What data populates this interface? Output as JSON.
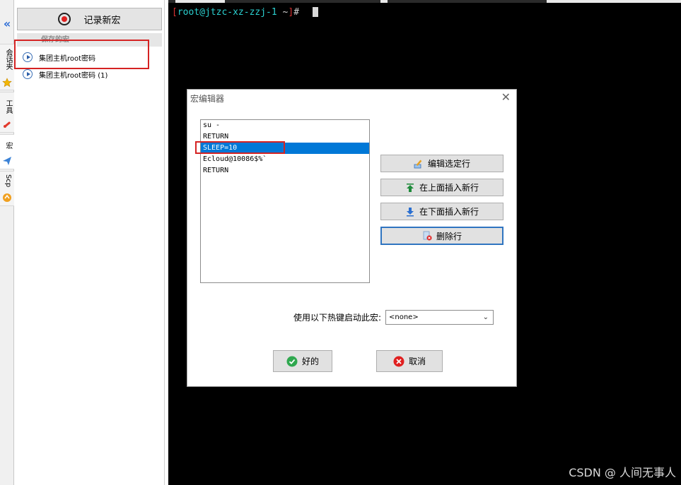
{
  "vtabs": {
    "session": "会话夹",
    "tools": "工具",
    "macro": "宏",
    "scp": "Scp"
  },
  "panel": {
    "record_label": "记录新宏",
    "saved_header": "保存的宏",
    "macros": [
      {
        "label": "集团主机root密码"
      },
      {
        "label": "集团主机root密码 (1)"
      }
    ]
  },
  "terminal": {
    "bracket_open": "[",
    "user_host": "root@jtzc-xz-zzj-1",
    "path": " ~",
    "bracket_close": "]",
    "symbol": "#"
  },
  "dialog": {
    "title": "宏编辑器",
    "lines": [
      {
        "text": "su -"
      },
      {
        "text": "RETURN"
      },
      {
        "text": "SLEEP=10"
      },
      {
        "text": "Ecloud@10086$%`"
      },
      {
        "text": "RETURN"
      }
    ],
    "selected_index": 2,
    "buttons": {
      "edit": "编辑选定行",
      "insert_above": "在上面插入新行",
      "insert_below": "在下面插入新行",
      "delete": "删除行",
      "ok": "好的",
      "cancel": "取消"
    },
    "hotkey_label": "使用以下热键启动此宏:",
    "hotkey_value": "<none>"
  },
  "watermark": "CSDN @ 人间无事人",
  "colors": {
    "selection": "#0078d7",
    "highlight_box": "#d52323",
    "terminal_bg": "#000000",
    "prompt_host": "#2bd0d0"
  }
}
